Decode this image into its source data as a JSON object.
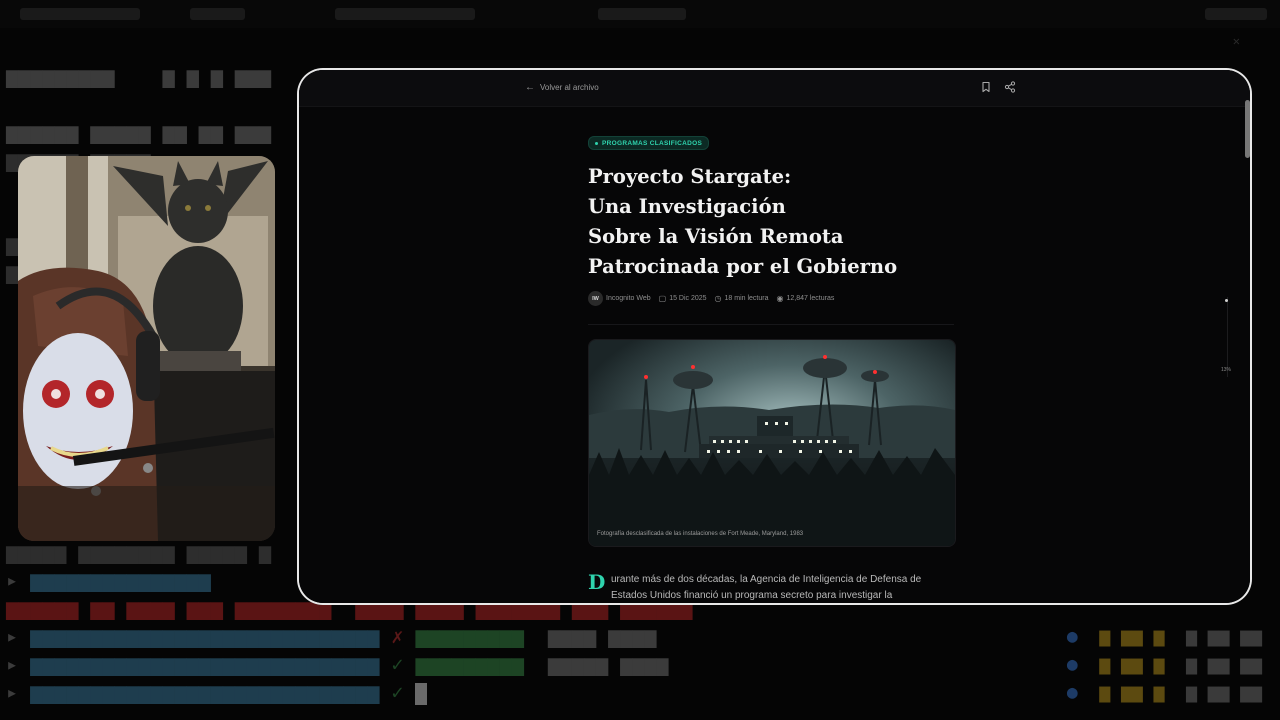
{
  "article": {
    "back_label": "Volver al archivo",
    "category": "PROGRAMAS CLASIFICADOS",
    "title_lines": [
      "Proyecto Stargate:",
      "Una Investigación",
      "Sobre la Visión Remota",
      "Patrocinada por el Gobierno"
    ],
    "author_initials": "IW",
    "author": "Incognito Web",
    "date": "15 Dic 2025",
    "read_time": "18 min lectura",
    "views": "12,847 lecturas",
    "image_caption": "Fotografía desclasificada de las instalaciones de Fort Meade, Maryland, 1983",
    "dropcap": "D",
    "body_line_1": "urante más de dos décadas, la Agencia de Inteligencia de Defensa de",
    "body_line_2": "Estados Unidos financió un programa secreto para investigar la",
    "progress_label": "13%",
    "progress": 0.13
  },
  "icons": {
    "back": "arrow-left-icon",
    "bookmark": "bookmark-icon",
    "share": "share-icon",
    "calendar": "calendar-icon",
    "clock": "clock-icon",
    "eye": "eye-icon"
  },
  "colors": {
    "accent": "#2fd3ad",
    "modal_border": "#e8e8e8",
    "background": "#050505"
  }
}
